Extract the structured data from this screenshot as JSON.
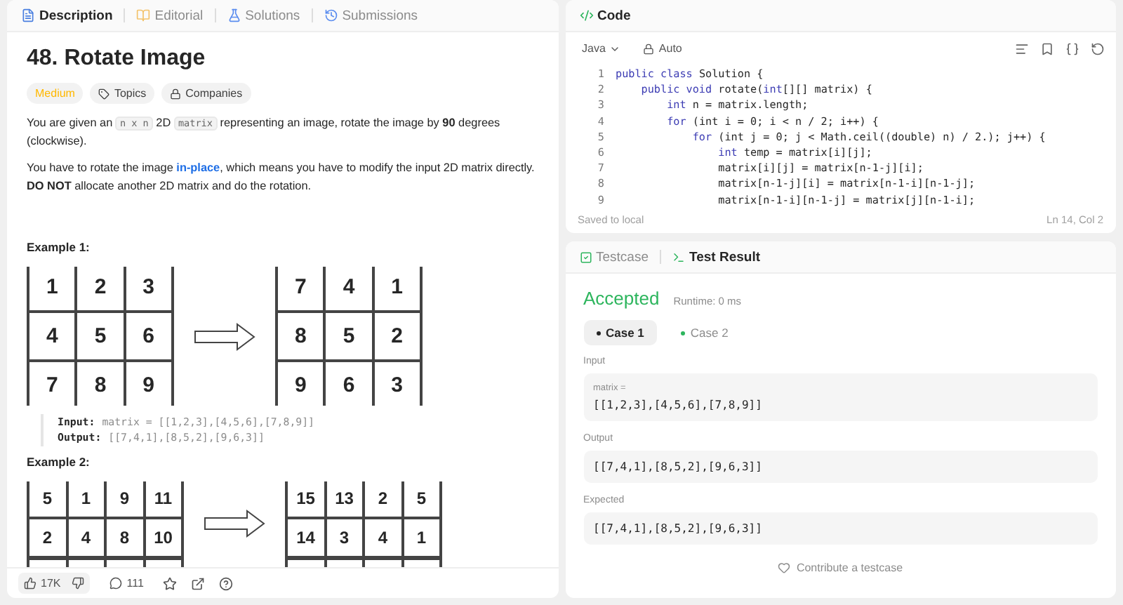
{
  "description_panel": {
    "tabs": [
      {
        "label": "Description",
        "selected": true
      },
      {
        "label": "Editorial",
        "selected": false
      },
      {
        "label": "Solutions",
        "selected": false
      },
      {
        "label": "Submissions",
        "selected": false
      }
    ],
    "title": "48. Rotate Image",
    "tags": [
      {
        "label": "Medium",
        "kind": "difficulty"
      },
      {
        "label": "Topics",
        "kind": "topics"
      },
      {
        "label": "Companies",
        "kind": "companies"
      }
    ],
    "paragraphs": [
      [
        {
          "text": "You are given an ",
          "kind": "text"
        },
        {
          "text": "n x n",
          "kind": "code"
        },
        {
          "text": " 2D ",
          "kind": "text"
        },
        {
          "text": "matrix",
          "kind": "code"
        },
        {
          "text": " representing an image, rotate the image by **90** degrees (clockwise).",
          "kind": "text"
        }
      ],
      [
        {
          "text": "You have to rotate the image ",
          "kind": "text"
        },
        {
          "text": "in-place",
          "kind": "link"
        },
        {
          "text": ", which means you have to modify the input 2D matrix directly. **DO NOT** allocate another 2D matrix and do the rotation.",
          "kind": "text"
        }
      ]
    ],
    "examples": [
      {
        "heading": "Example 1:",
        "before": [
          [
            "1",
            "2",
            "3"
          ],
          [
            "4",
            "5",
            "6"
          ],
          [
            "7",
            "8",
            "9"
          ]
        ],
        "after": [
          [
            "7",
            "4",
            "1"
          ],
          [
            "8",
            "5",
            "2"
          ],
          [
            "9",
            "6",
            "3"
          ]
        ],
        "cut": false,
        "input_label": "Input:",
        "input": "matrix = [[1,2,3],[4,5,6],[7,8,9]]",
        "output_label": "Output:",
        "output": "[[7,4,1],[8,5,2],[9,6,3]]"
      },
      {
        "heading": "Example 2:",
        "before": [
          [
            "5",
            "1",
            "9",
            "11"
          ],
          [
            "2",
            "4",
            "8",
            "10"
          ]
        ],
        "after": [
          [
            "15",
            "13",
            "2",
            "5"
          ],
          [
            "14",
            "3",
            "4",
            "1"
          ]
        ],
        "cut": true
      }
    ],
    "footer": {
      "likes": "17K",
      "comments": "111"
    }
  },
  "code_panel": {
    "title": "Code",
    "language": "Java",
    "mode": "Auto",
    "lines": [
      {
        "number": "1",
        "tokens": [
          {
            "text": "public class ",
            "kind": "keyword"
          },
          {
            "text": "Solution {",
            "kind": "plain"
          }
        ]
      },
      {
        "number": "2",
        "tokens": [
          {
            "text": "    public void ",
            "kind": "keyword"
          },
          {
            "text": "rotate(",
            "kind": "plain"
          },
          {
            "text": "int",
            "kind": "keyword"
          },
          {
            "text": "[][] matrix) {",
            "kind": "plain"
          }
        ]
      },
      {
        "number": "3",
        "tokens": [
          {
            "text": "        int ",
            "kind": "keyword"
          },
          {
            "text": "n = matrix.length;",
            "kind": "plain"
          }
        ]
      },
      {
        "number": "4",
        "tokens": [
          {
            "text": "        for ",
            "kind": "keyword"
          },
          {
            "text": "(int i = 0; i < n / 2; i++) {",
            "kind": "plain"
          }
        ]
      },
      {
        "number": "5",
        "tokens": [
          {
            "text": "            for ",
            "kind": "keyword"
          },
          {
            "text": "(int j = 0; j < Math.ceil((double) n) / 2.); j++) {",
            "kind": "plain"
          }
        ]
      },
      {
        "number": "6",
        "tokens": [
          {
            "text": "                int ",
            "kind": "keyword"
          },
          {
            "text": "temp = matrix[i][j];",
            "kind": "plain"
          }
        ]
      },
      {
        "number": "7",
        "tokens": [
          {
            "text": "                matrix[i][j] = matrix[n-1-j][i];",
            "kind": "plain"
          }
        ]
      },
      {
        "number": "8",
        "tokens": [
          {
            "text": "                matrix[n-1-j][i] = matrix[n-1-i][n-1-j];",
            "kind": "plain"
          }
        ]
      },
      {
        "number": "9",
        "tokens": [
          {
            "text": "                matrix[n-1-i][n-1-j] = matrix[j][n-1-i];",
            "kind": "plain"
          }
        ]
      }
    ],
    "saved": "Saved to local",
    "cursor": "Ln 14, Col 2"
  },
  "test_panel": {
    "tabs": [
      {
        "label": "Testcase",
        "selected": false
      },
      {
        "label": "Test Result",
        "selected": true
      }
    ],
    "status": "Accepted",
    "runtime": "Runtime: 0 ms",
    "cases": [
      {
        "label": "Case 1",
        "selected": true
      },
      {
        "label": "Case 2",
        "selected": false
      }
    ],
    "input_label": "Input",
    "param": "matrix =",
    "input": "[[1,2,3],[4,5,6],[7,8,9]]",
    "output_label": "Output",
    "output": "[[7,4,1],[8,5,2],[9,6,3]]",
    "expected_label": "Expected",
    "expected": "[[7,4,1],[8,5,2],[9,6,3]]",
    "contribute": "Contribute a testcase"
  }
}
